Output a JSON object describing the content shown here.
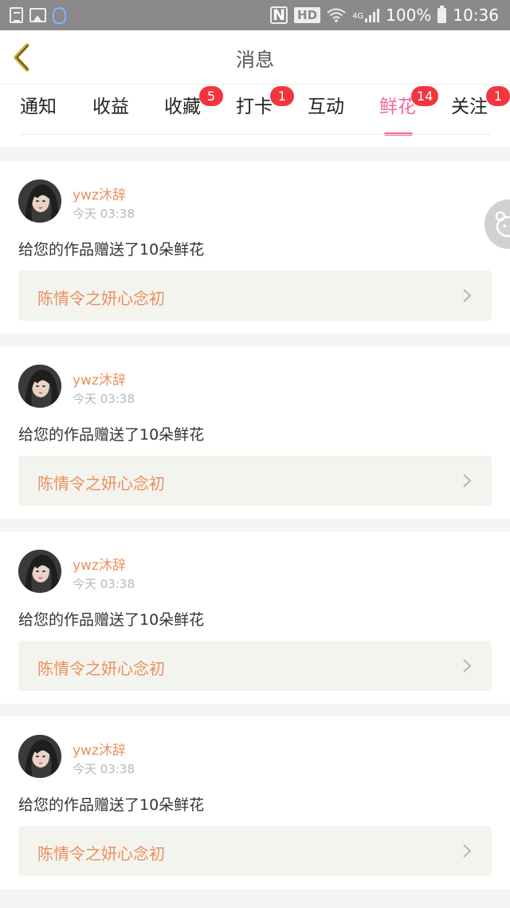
{
  "status_bar": {
    "battery": "100%",
    "time": "10:36",
    "nfc_label": "N",
    "hd_label": "HD",
    "network_label": "4G",
    "icons": [
      "document-icon",
      "image-icon",
      "qq-icon",
      "nfc-icon",
      "hd-icon",
      "wifi-icon",
      "signal-icon",
      "battery-icon"
    ]
  },
  "header": {
    "title": "消息",
    "back_icon": "back-chevron-icon"
  },
  "tabs": [
    {
      "label": "通知",
      "badge": null,
      "active": false
    },
    {
      "label": "收益",
      "badge": null,
      "active": false
    },
    {
      "label": "收藏",
      "badge": "5",
      "active": false
    },
    {
      "label": "打卡",
      "badge": "1",
      "active": false
    },
    {
      "label": "互动",
      "badge": null,
      "active": false
    },
    {
      "label": "鲜花",
      "badge": "14",
      "active": true
    },
    {
      "label": "关注",
      "badge": "1",
      "active": false
    }
  ],
  "messages": [
    {
      "sender": "ywz沐辞",
      "time": "今天 03:38",
      "text": "给您的作品赠送了10朵鲜花",
      "work_title": "陈情令之妍心念初"
    },
    {
      "sender": "ywz沐辞",
      "time": "今天 03:38",
      "text": "给您的作品赠送了10朵鲜花",
      "work_title": "陈情令之妍心念初"
    },
    {
      "sender": "ywz沐辞",
      "time": "今天 03:38",
      "text": "给您的作品赠送了10朵鲜花",
      "work_title": "陈情令之妍心念初"
    },
    {
      "sender": "ywz沐辞",
      "time": "今天 03:38",
      "text": "给您的作品赠送了10朵鲜花",
      "work_title": "陈情令之妍心念初"
    }
  ],
  "colors": {
    "accent_pink": "#f06a9e",
    "badge_red": "#f2353f",
    "sender_orange": "#e9905c",
    "back_arrow": "#c9a227"
  }
}
